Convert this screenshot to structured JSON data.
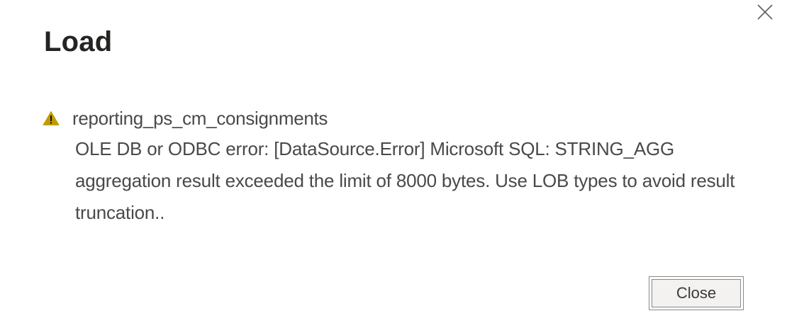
{
  "dialog": {
    "title": "Load",
    "close_icon": "close-icon",
    "message": {
      "icon": "warning-icon",
      "icon_color": "#C19C00",
      "query_name": "reporting_ps_cm_consignments",
      "error_text": "OLE DB or ODBC error: [DataSource.Error] Microsoft SQL: STRING_AGG aggregation result exceeded the limit of 8000 bytes. Use LOB types to avoid result truncation.."
    },
    "buttons": {
      "close_label": "Close"
    }
  }
}
